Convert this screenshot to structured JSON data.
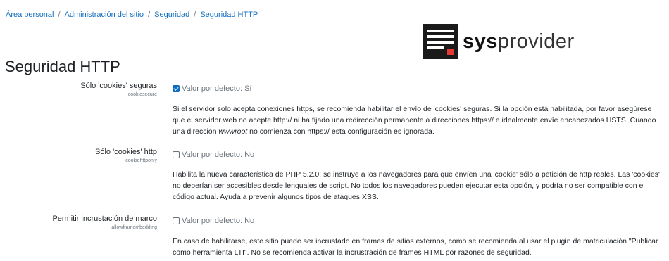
{
  "breadcrumb": {
    "items": [
      "Área personal",
      "Administración del sitio",
      "Seguridad",
      "Seguridad HTTP"
    ],
    "separator": "/"
  },
  "logo": {
    "bold": "sys",
    "regular": "provider"
  },
  "page_title": "Seguridad HTTP",
  "settings": [
    {
      "label": "Sólo 'cookies' seguras",
      "key": "cookiesecure",
      "checked": true,
      "default_text": "Valor por defecto: Sí",
      "desc_pre": "Si el servidor solo acepta conexiones https, se recomienda habilitar el envío de 'cookies' seguras. Si la opción está habilitada, por favor asegúrese que el servidor web no acepte http:// ni ha fijado una redirección permanente a direcciones https:// e idealmente envíe encabezados HSTS. Cuando una dirección ",
      "desc_em": "wwwroot",
      "desc_post": " no comienza con https:// esta configuración es ignorada."
    },
    {
      "label": "Sólo 'cookies' http",
      "key": "cookiehttponly",
      "checked": false,
      "default_text": "Valor por defecto: No",
      "desc": "Habilita la nueva característica de PHP 5.2.0: se instruye a los navegadores para que envíen una 'cookie' sólo a petición de http reales. Las 'cookies' no deberían ser accesibles desde lenguajes de script. No todos los navegadores pueden ejecutar esta opción, y podría no ser compatible con el código actual. Ayuda a prevenir algunos tipos de ataques XSS."
    },
    {
      "label": "Permitir incrustación de marco",
      "key": "allowframembedding",
      "checked": false,
      "default_text": "Valor por defecto: No",
      "desc": "En caso de habilitarse, este sitio puede ser incrustado en frames de sitios externos, como se recomienda al usar el plugin de matriculación \"Publicar como herramienta LTI\". No se recomienda activar la incrustración de frames HTML por razones de seguridad."
    }
  ],
  "colors": {
    "link": "#0f6cbf",
    "muted": "#6a737b",
    "text": "#1d2125",
    "logo_red": "#e53935"
  }
}
